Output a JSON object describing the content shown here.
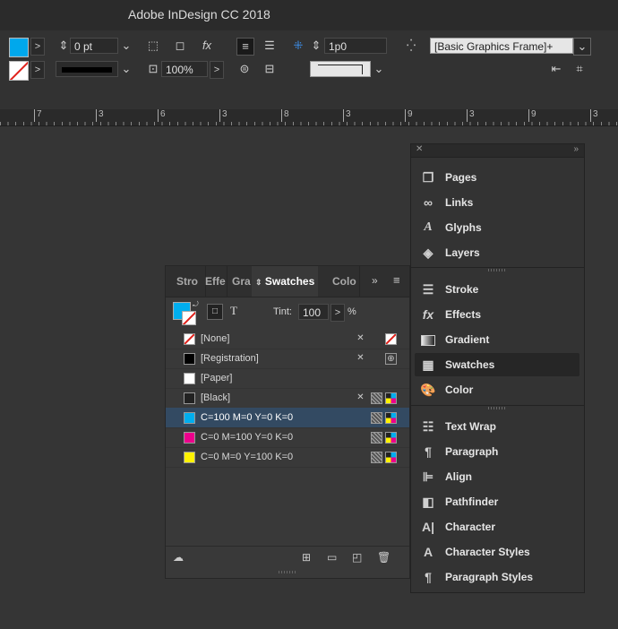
{
  "app": {
    "title": "Adobe InDesign CC 2018"
  },
  "control_bar": {
    "stroke_weight": "0 pt",
    "scale": "100%",
    "offset": "1p0",
    "object_style": "[Basic Graphics Frame]+",
    "fill_color": "#00a8ec",
    "icons": [
      "select-container-icon",
      "frame-fitting-icon",
      "fx-icon",
      "align-icon",
      "distribute-icon"
    ]
  },
  "ruler": {
    "ticks": [
      {
        "label": "7"
      },
      {
        "label": "3"
      },
      {
        "label": "6"
      },
      {
        "label": "3"
      },
      {
        "label": "8"
      },
      {
        "label": "3"
      },
      {
        "label": "9"
      },
      {
        "label": "3"
      }
    ]
  },
  "swatches_panel": {
    "tabs": [
      {
        "label": "Stro"
      },
      {
        "label": "Effe"
      },
      {
        "label": "Gra"
      },
      {
        "label": "Swatches"
      },
      {
        "label": "Colo"
      }
    ],
    "tint_label": "Tint:",
    "tint_value": "100",
    "tint_unit": "%",
    "text_icon": "T",
    "swatches": [
      {
        "name": "[None]",
        "color": "none"
      },
      {
        "name": "[Registration]",
        "color": "#000000"
      },
      {
        "name": "[Paper]",
        "color": "#ffffff"
      },
      {
        "name": "[Black]",
        "color": "#222222"
      },
      {
        "name": "C=100 M=0 Y=0 K=0",
        "color": "#00aeef"
      },
      {
        "name": "C=0 M=100 Y=0 K=0",
        "color": "#ec008c"
      },
      {
        "name": "C=0 M=0 Y=100 K=0",
        "color": "#fff200"
      }
    ]
  },
  "dock": {
    "groups": [
      [
        {
          "label": "Pages",
          "icon": "pages-icon"
        },
        {
          "label": "Links",
          "icon": "links-icon"
        },
        {
          "label": "Glyphs",
          "icon": "glyphs-icon"
        },
        {
          "label": "Layers",
          "icon": "layers-icon"
        }
      ],
      [
        {
          "label": "Stroke",
          "icon": "stroke-icon"
        },
        {
          "label": "Effects",
          "icon": "effects-icon"
        },
        {
          "label": "Gradient",
          "icon": "gradient-icon"
        },
        {
          "label": "Swatches",
          "icon": "swatches-icon"
        },
        {
          "label": "Color",
          "icon": "color-icon"
        }
      ],
      [
        {
          "label": "Text Wrap",
          "icon": "text-wrap-icon"
        },
        {
          "label": "Paragraph",
          "icon": "paragraph-icon"
        },
        {
          "label": "Align",
          "icon": "align-icon"
        },
        {
          "label": "Pathfinder",
          "icon": "pathfinder-icon"
        },
        {
          "label": "Character",
          "icon": "character-icon"
        },
        {
          "label": "Character Styles",
          "icon": "character-styles-icon"
        },
        {
          "label": "Paragraph Styles",
          "icon": "paragraph-styles-icon"
        }
      ]
    ]
  }
}
